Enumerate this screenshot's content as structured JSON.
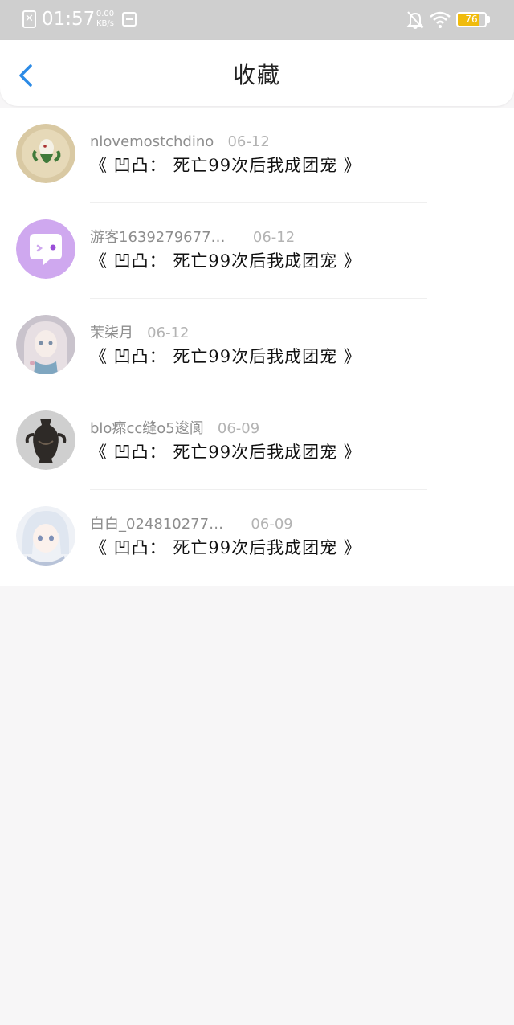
{
  "status_bar": {
    "time": "01:57",
    "net_speed_value": "0.00",
    "net_speed_unit": "KB/s",
    "battery_level": "76",
    "battery_color": "#f0bb0c"
  },
  "header": {
    "title": "收藏",
    "accent_color": "#2b8ae6"
  },
  "favorites": [
    {
      "user": "nlovemostchdino",
      "date": "06-12",
      "book": "《 凹凸： 死亡99次后我成团宠 》",
      "avatar_icon": "bird-avatar"
    },
    {
      "user": "游客1639279677…",
      "date": "06-12",
      "book": "《 凹凸： 死亡99次后我成团宠 》",
      "avatar_icon": "chat-bubble-avatar"
    },
    {
      "user": "茉柒月",
      "date": "06-12",
      "book": "《 凹凸： 死亡99次后我成团宠 》",
      "avatar_icon": "anime-girl-avatar"
    },
    {
      "user": "blo瘝cc缝o5逡阆",
      "date": "06-09",
      "book": "《 凹凸： 死亡99次后我成团宠 》",
      "avatar_icon": "bronze-vase-avatar"
    },
    {
      "user": "白白_024810277…",
      "date": "06-09",
      "book": "《 凹凸： 死亡99次后我成团宠 》",
      "avatar_icon": "silver-hair-girl-avatar"
    }
  ]
}
